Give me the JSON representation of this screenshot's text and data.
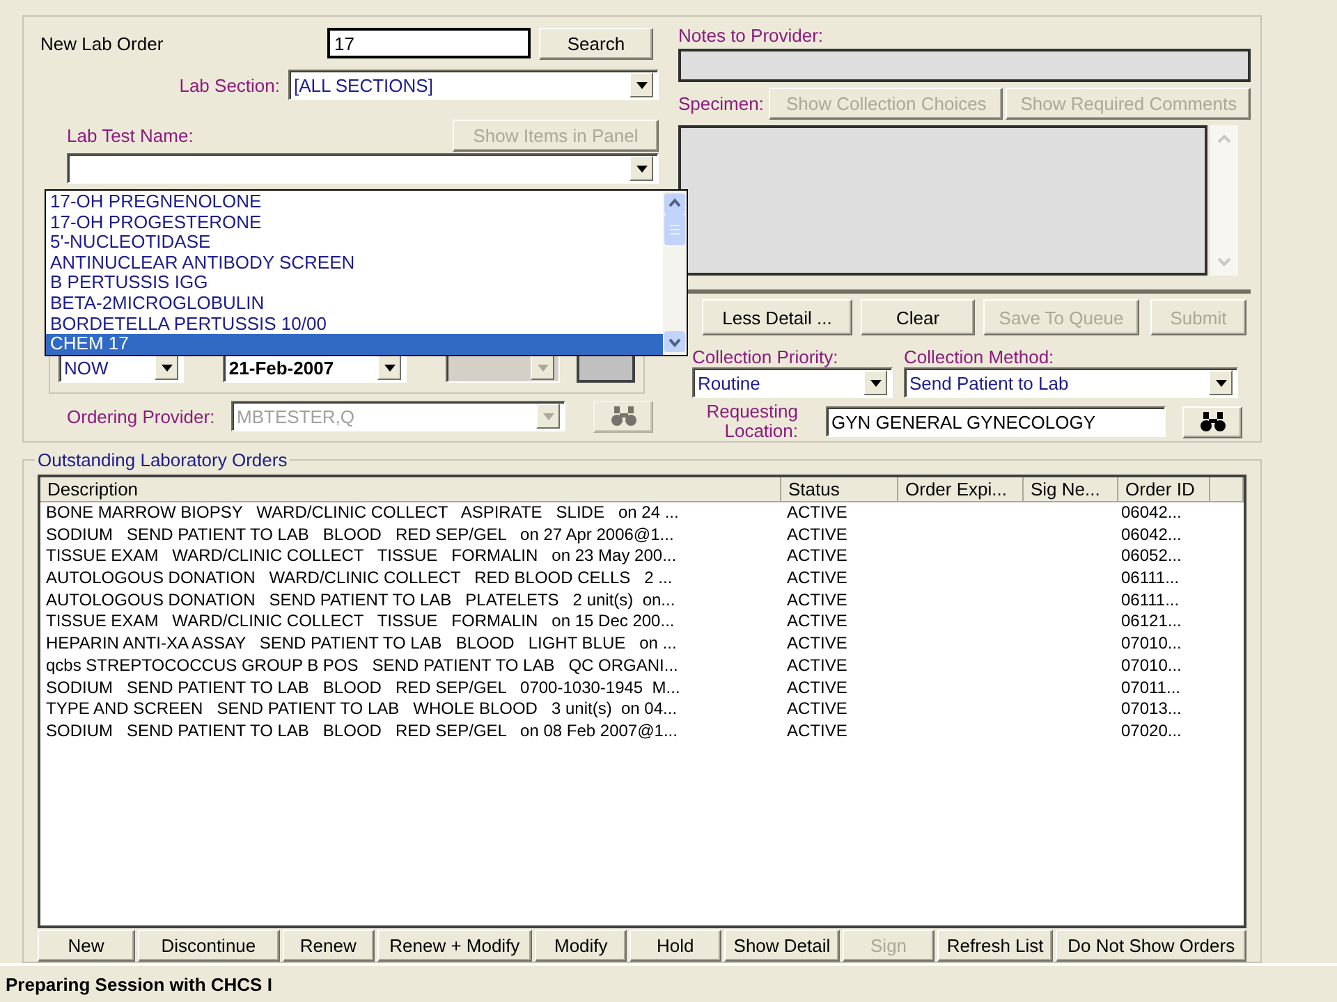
{
  "new_order": {
    "title": "New Lab Order",
    "search_value": "17",
    "search_button": {
      "label": "Search",
      "disabled": false
    },
    "lab_section": {
      "label": "Lab Section:",
      "value": "[ALL SECTIONS]"
    },
    "lab_test": {
      "label": "Lab Test Name:",
      "panel_button": {
        "label": "Show Items in Panel",
        "disabled": true
      }
    },
    "test_list": [
      {
        "name": "17-OH PREGNENOLONE",
        "selected": false
      },
      {
        "name": "17-OH PROGESTERONE",
        "selected": false
      },
      {
        "name": "5'-NUCLEOTIDASE",
        "selected": false
      },
      {
        "name": "ANTINUCLEAR ANTIBODY SCREEN",
        "selected": false
      },
      {
        "name": "B PERTUSSIS IGG",
        "selected": false
      },
      {
        "name": "BETA-2MICROGLOBULIN",
        "selected": false
      },
      {
        "name": "BORDETELLA PERTUSSIS 10/00",
        "selected": false
      },
      {
        "name": "CHEM 17",
        "selected": true
      }
    ],
    "timing": {
      "value": "NOW"
    },
    "start_date": {
      "value": "21-Feb-2007"
    },
    "ordering_provider": {
      "label": "Ordering Provider:",
      "value": "MBTESTER,Q",
      "disabled": true
    }
  },
  "notes": {
    "label": "Notes to Provider:"
  },
  "specimen": {
    "label": "Specimen:",
    "buttons": [
      {
        "label": "Show Collection Choices",
        "disabled": true
      },
      {
        "label": "Show Required Comments",
        "disabled": true
      }
    ]
  },
  "actions": [
    {
      "label": "Less Detail ...",
      "disabled": false
    },
    {
      "label": "Clear",
      "disabled": false
    },
    {
      "label": "Save To Queue",
      "disabled": true
    },
    {
      "label": "Submit",
      "disabled": true
    }
  ],
  "collection_priority": {
    "label": "Collection Priority:",
    "value": "Routine"
  },
  "collection_method": {
    "label": "Collection Method:",
    "value": "Send Patient to Lab"
  },
  "requesting_location": {
    "label": "Requesting Location:",
    "value": "GYN GENERAL GYNECOLOGY"
  },
  "orders": {
    "title": "Outstanding Laboratory Orders",
    "columns": [
      "Description",
      "Status",
      "Order Expi...",
      "Sig Ne...",
      "Order ID"
    ],
    "rows": [
      {
        "description": "BONE MARROW BIOPSY   WARD/CLINIC COLLECT   ASPIRATE   SLIDE   on 24 ...",
        "status": "ACTIVE",
        "order_id": "06042..."
      },
      {
        "description": "SODIUM   SEND PATIENT TO LAB   BLOOD   RED SEP/GEL   on 27 Apr 2006@1...",
        "status": "ACTIVE",
        "order_id": "06042..."
      },
      {
        "description": "TISSUE EXAM   WARD/CLINIC COLLECT   TISSUE   FORMALIN   on 23 May 200...",
        "status": "ACTIVE",
        "order_id": "06052..."
      },
      {
        "description": "AUTOLOGOUS DONATION   WARD/CLINIC COLLECT   RED BLOOD CELLS   2 ...",
        "status": "ACTIVE",
        "order_id": "06111..."
      },
      {
        "description": "AUTOLOGOUS DONATION   SEND PATIENT TO LAB   PLATELETS   2 unit(s)  on...",
        "status": "ACTIVE",
        "order_id": "06111..."
      },
      {
        "description": "TISSUE EXAM   WARD/CLINIC COLLECT   TISSUE   FORMALIN   on 15 Dec 200...",
        "status": "ACTIVE",
        "order_id": "06121..."
      },
      {
        "description": "HEPARIN ANTI-XA ASSAY   SEND PATIENT TO LAB   BLOOD   LIGHT BLUE   on ...",
        "status": "ACTIVE",
        "order_id": "07010..."
      },
      {
        "description": "qcbs STREPTOCOCCUS GROUP B POS   SEND PATIENT TO LAB   QC ORGANI...",
        "status": "ACTIVE",
        "order_id": "07010..."
      },
      {
        "description": "SODIUM   SEND PATIENT TO LAB   BLOOD   RED SEP/GEL   0700-1030-1945  M...",
        "status": "ACTIVE",
        "order_id": "07011..."
      },
      {
        "description": "TYPE AND SCREEN   SEND PATIENT TO LAB   WHOLE BLOOD   3 unit(s)  on 04...",
        "status": "ACTIVE",
        "order_id": "07013..."
      },
      {
        "description": "SODIUM   SEND PATIENT TO LAB   BLOOD   RED SEP/GEL   on 08 Feb 2007@1...",
        "status": "ACTIVE",
        "order_id": "07020..."
      }
    ]
  },
  "order_buttons": [
    {
      "label": "New",
      "disabled": false
    },
    {
      "label": "Discontinue",
      "disabled": false
    },
    {
      "label": "Renew",
      "disabled": false
    },
    {
      "label": "Renew + Modify",
      "disabled": false
    },
    {
      "label": "Modify",
      "disabled": false
    },
    {
      "label": "Hold",
      "disabled": false
    },
    {
      "label": "Show Detail",
      "disabled": false
    },
    {
      "label": "Sign",
      "disabled": true
    },
    {
      "label": "Refresh List",
      "disabled": false
    },
    {
      "label": "Do Not Show Orders",
      "disabled": false
    }
  ],
  "status_bar": "Preparing Session with CHCS I"
}
